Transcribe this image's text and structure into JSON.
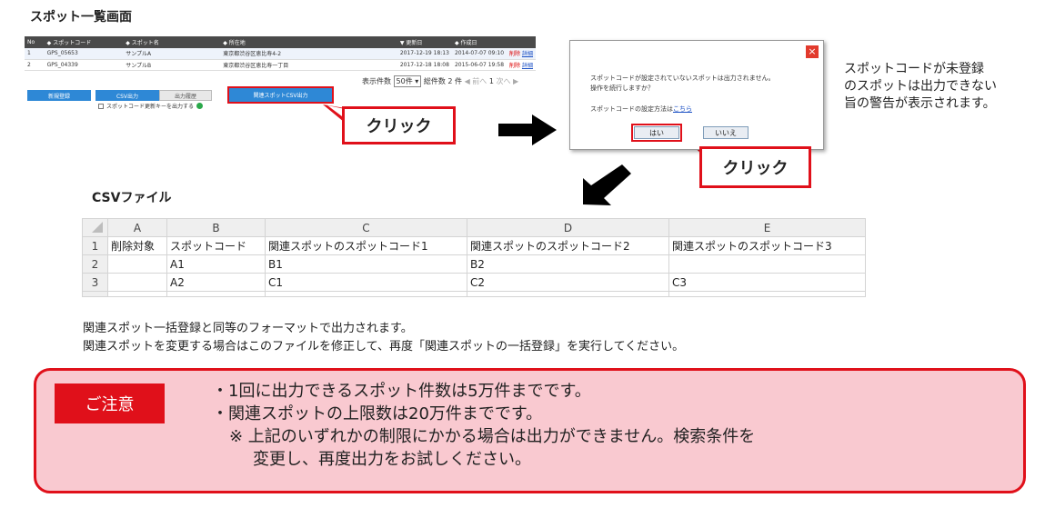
{
  "section_title": "スポット一覧画面",
  "spot_list": {
    "columns": [
      "No",
      "スポットコード",
      "スポット名",
      "所在地",
      "更新日",
      "作成日",
      ""
    ],
    "rows": [
      {
        "no": "1",
        "code": "GPS_05653",
        "name": "サンプルA",
        "address": "東京都渋谷区恵比寿4-2",
        "updated": "2017-12-19 18:13",
        "created": "2014-07-07 09:10",
        "action1": "削除",
        "action2": "詳細"
      },
      {
        "no": "2",
        "code": "GPS_04339",
        "name": "サンプルB",
        "address": "東京都渋谷区恵比寿一丁目",
        "updated": "2017-12-18 18:08",
        "created": "2015-06-07 19:58",
        "action1": "削除",
        "action2": "詳細"
      }
    ],
    "pager": {
      "label": "表示件数",
      "per_page": "50件",
      "total_label": "総件数 2 件",
      "prev": "前へ",
      "page": "1",
      "next": "次へ"
    },
    "buttons": {
      "new": "新規登録",
      "csv": "CSV出力",
      "history": "出力履歴",
      "related_csv": "関連スポットCSV出力"
    },
    "checkbox_label": "スポットコード更新キーを出力する"
  },
  "callouts": {
    "click1": "クリック",
    "click2": "クリック"
  },
  "dialog": {
    "close": "×",
    "message1": "スポットコードが設定されていないスポットは出力されません。",
    "message2": "操作を続行しますか？",
    "message3_prefix": "スポットコードの設定方法は",
    "message3_link": "こちら",
    "yes": "はい",
    "no": "いいえ"
  },
  "side_note": {
    "line1": "スポットコードが未登録",
    "line2": "のスポットは出力できない",
    "line3": "旨の警告が表示されます。"
  },
  "csv": {
    "title": "CSVファイル",
    "col_letters": [
      "A",
      "B",
      "C",
      "D",
      "E"
    ],
    "headers": [
      "削除対象",
      "スポットコード",
      "関連スポットのスポットコード1",
      "関連スポットのスポットコード2",
      "関連スポットのスポットコード3"
    ],
    "rows": [
      {
        "num": "2",
        "cells": [
          "",
          "A1",
          "B1",
          "B2",
          ""
        ]
      },
      {
        "num": "3",
        "cells": [
          "",
          "A2",
          "C1",
          "C2",
          "C3"
        ]
      }
    ],
    "description1": "関連スポット一括登録と同等のフォーマットで出力されます。",
    "description2": "関連スポットを変更する場合はこのファイルを修正して、再度「関連スポットの一括登録」を実行してください。"
  },
  "caution": {
    "badge": "ご注意",
    "line1": "・1回に出力できるスポット件数は5万件までです。",
    "line2": "・関連スポットの上限数は20万件までです。",
    "line3": "※ 上記のいずれかの制限にかかる場合は出力ができません。検索条件を",
    "line4": "変更し、再度出力をお試しください。"
  },
  "colors": {
    "accent_red": "#e0101a",
    "button_blue": "#2e88d6",
    "caution_bg": "#f9c9d0",
    "header_dark": "#4a4a4a"
  }
}
